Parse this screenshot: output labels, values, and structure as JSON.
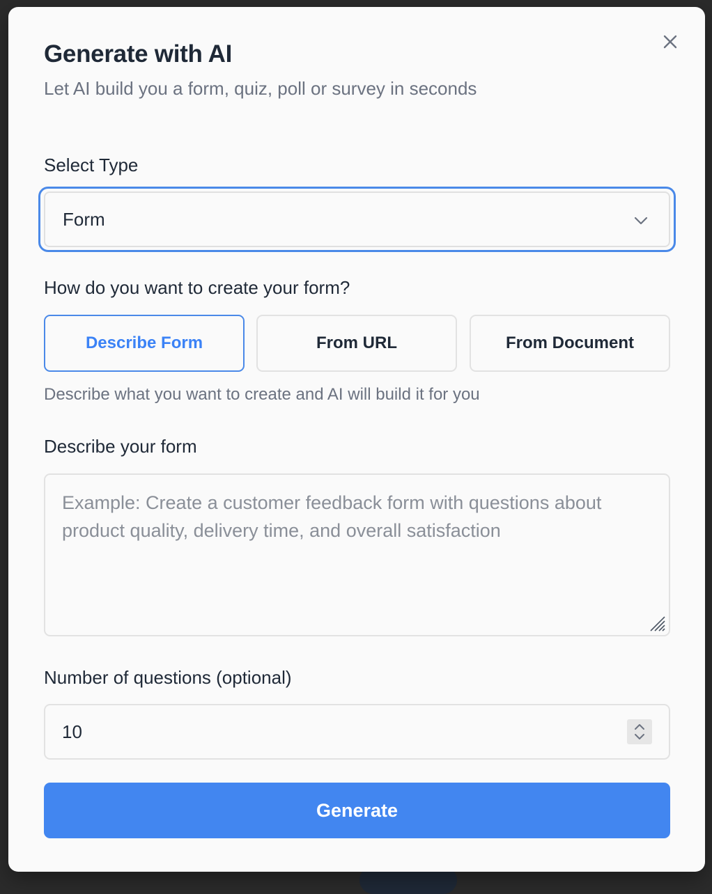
{
  "modal": {
    "title": "Generate with AI",
    "subtitle": "Let AI build you a form, quiz, poll or survey in seconds"
  },
  "select_type": {
    "label": "Select Type",
    "value": "Form"
  },
  "create_method": {
    "question": "How do you want to create your form?",
    "options": [
      {
        "label": "Describe Form",
        "active": true
      },
      {
        "label": "From URL",
        "active": false
      },
      {
        "label": "From Document",
        "active": false
      }
    ],
    "hint": "Describe what you want to create and AI will build it for you"
  },
  "description": {
    "label": "Describe your form",
    "placeholder": "Example: Create a customer feedback form with questions about product quality, delivery time, and overall satisfaction",
    "value": ""
  },
  "questions": {
    "label": "Number of questions (optional)",
    "value": "10"
  },
  "actions": {
    "generate_label": "Generate"
  },
  "colors": {
    "accent": "#4286f0",
    "focus_ring": "#4a89e8",
    "text": "#1f2937",
    "muted": "#6b7280"
  },
  "icons": {
    "close": "close-icon",
    "dropdown": "chevron-down-icon",
    "stepper": "stepper-icon",
    "resize": "resize-grip-icon"
  }
}
